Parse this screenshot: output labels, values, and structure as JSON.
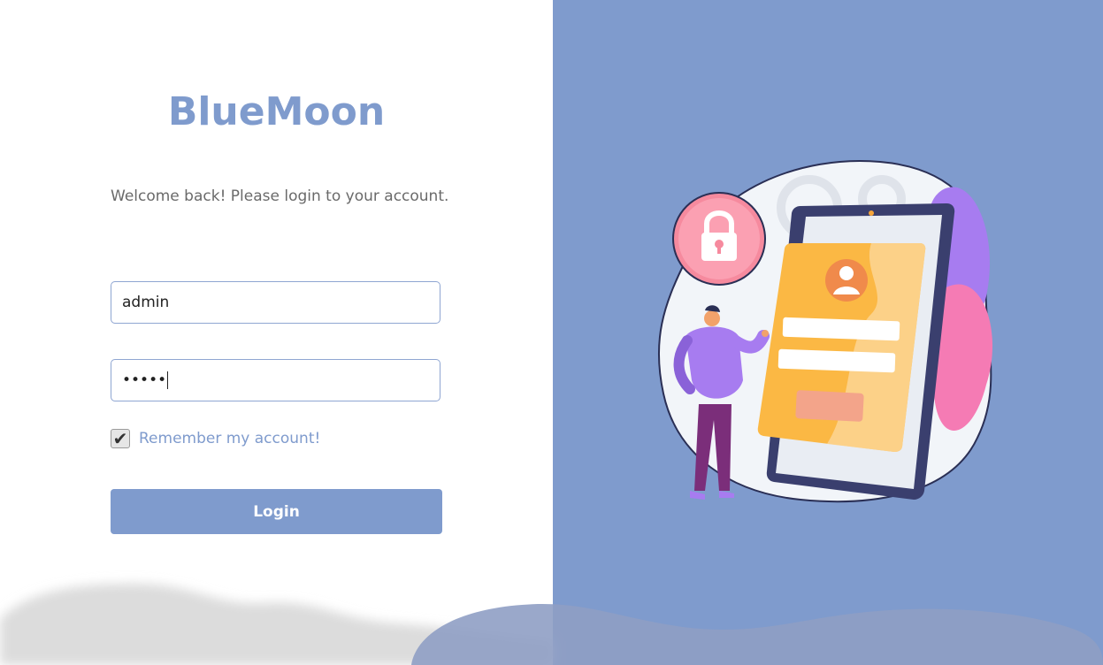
{
  "brand": {
    "title": "BlueMoon"
  },
  "welcome_text": "Welcome back! Please login to your account.",
  "form": {
    "username_value": "admin",
    "password_masked": "•••••",
    "remember_checked": true,
    "remember_label": "Remember my account!",
    "login_label": "Login"
  },
  "icons": {
    "checkbox_mark": "check-icon",
    "illustration": "login-illustration"
  },
  "colors": {
    "accent": "#7f9bcd",
    "field_border": "#8fa6d2",
    "text_muted": "#6a6a6a"
  }
}
